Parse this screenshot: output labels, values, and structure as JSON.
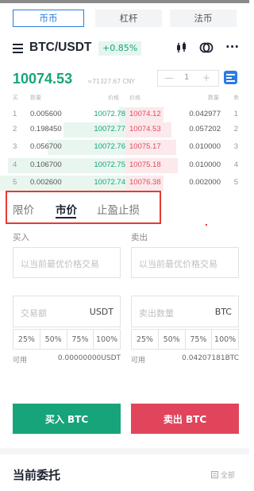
{
  "market_tabs": [
    "币币",
    "杠杆",
    "法币"
  ],
  "header": {
    "pair": "BTC/USDT",
    "change": "+0.85%",
    "more": "···"
  },
  "ticker": {
    "price": "10074.53",
    "cny": "≈71327.67 CNY",
    "stepper_minus": "—",
    "stepper_value": "1",
    "stepper_plus": "+"
  },
  "orderbook": {
    "headers": {
      "buy": "买",
      "qty": "数量",
      "bid_price": "价格",
      "ask_price": "价格",
      "ask_qty": "数量",
      "sell": "卖"
    },
    "rows": [
      {
        "n": "1",
        "bid_qty": "0.005600",
        "bid_price": "10072.78",
        "ask_price": "10074.12",
        "ask_qty": "0.042977",
        "m": "1"
      },
      {
        "n": "2",
        "bid_qty": "0.198450",
        "bid_price": "10072.77",
        "ask_price": "10074.53",
        "ask_qty": "0.057202",
        "m": "2"
      },
      {
        "n": "3",
        "bid_qty": "0.056700",
        "bid_price": "10072.76",
        "ask_price": "10075.17",
        "ask_qty": "0.010000",
        "m": "3"
      },
      {
        "n": "4",
        "bid_qty": "0.106700",
        "bid_price": "10072.75",
        "ask_price": "10075.18",
        "ask_qty": "0.010000",
        "m": "4"
      },
      {
        "n": "5",
        "bid_qty": "0.002600",
        "bid_price": "10072.74",
        "ask_price": "10076.38",
        "ask_qty": "0.002000",
        "m": "5"
      }
    ]
  },
  "order_types": {
    "limit": "限价",
    "market": "市价",
    "stop": "止盈止损",
    "active": "市价"
  },
  "buy": {
    "label": "买入",
    "price_placeholder": "以当前最优价格交易",
    "amount_label": "交易额",
    "amount_unit": "USDT",
    "percents": [
      "25%",
      "50%",
      "75%",
      "100%"
    ],
    "avail_label": "可用",
    "avail_value": "0.00000000USDT",
    "button": "买入 BTC"
  },
  "sell": {
    "label": "卖出",
    "price_placeholder": "以当前最优价格交易",
    "amount_label": "卖出数量",
    "amount_unit": "BTC",
    "percents": [
      "25%",
      "50%",
      "75%",
      "100%"
    ],
    "avail_label": "可用",
    "avail_value": "0.04207181BTC",
    "button": "卖出 BTC"
  },
  "orders": {
    "title": "当前委托",
    "all": "全部"
  },
  "colors": {
    "accent": "#2a7be4",
    "buy_green": "#17a47b",
    "sell_red": "#e0455c",
    "highlight_box": "#e53935"
  }
}
